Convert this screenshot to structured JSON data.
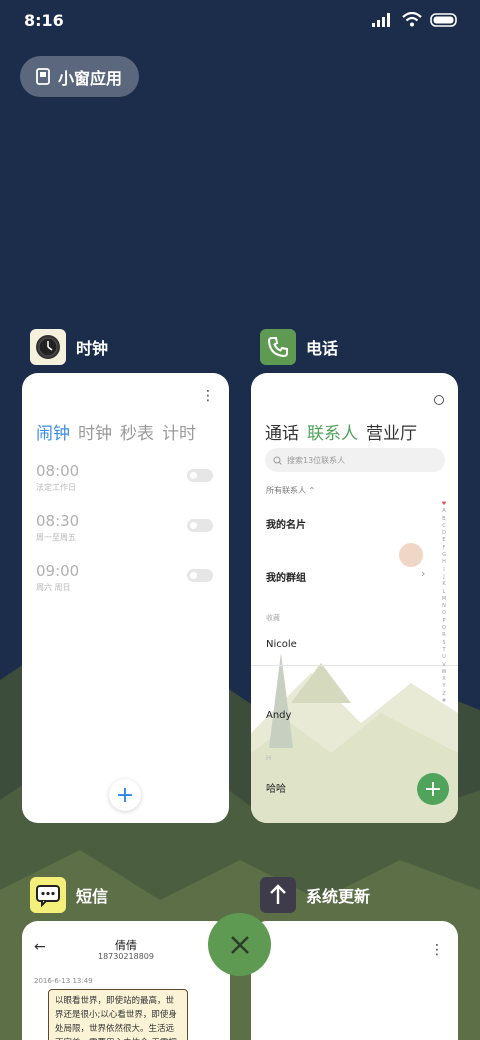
{
  "status_bar": {
    "time": "8:16"
  },
  "mini_window": {
    "label": "小窗应用"
  },
  "apps": {
    "clock": {
      "name": "时钟",
      "tabs": [
        "闹钟",
        "计时",
        "秒表",
        "计时"
      ],
      "tab_labels": {
        "alarm": "闹钟",
        "world": "时钟",
        "stopwatch": "秒表",
        "timer": "计时"
      },
      "alarms": [
        {
          "time": "08:00",
          "repeat": "法定工作日"
        },
        {
          "time": "08:30",
          "repeat": "周一至周五"
        },
        {
          "time": "09:00",
          "repeat": "周六 周日"
        }
      ],
      "add_label": "+"
    },
    "phone": {
      "name": "电话",
      "tabs": {
        "calls": "通话",
        "contacts": "联系人",
        "service": "营业厅"
      },
      "search_placeholder": "搜索13位联系人",
      "filter_label": "所有联系人",
      "my_card": "我的名片",
      "my_groups": "我的群组",
      "favorites_label": "收藏",
      "contacts": [
        "Nicole",
        "Andy",
        "哈哈"
      ],
      "section_h": "H",
      "index_letters": [
        "♥",
        "A",
        "B",
        "C",
        "D",
        "E",
        "F",
        "G",
        "H",
        "I",
        "J",
        "K",
        "L",
        "M",
        "N",
        "O",
        "P",
        "Q",
        "R",
        "S",
        "T",
        "U",
        "V",
        "W",
        "X",
        "Y",
        "Z",
        "#"
      ],
      "add_label": "+"
    },
    "sms": {
      "name": "短信",
      "contact_name": "倩倩",
      "contact_number": "18730218809",
      "date": "2016-6-13 13:49",
      "message": "以眼看世界，即使站的最高，世界还是很小;以心看世界，即使身处局限，世界依然很大。生活远不完美，需要用心去体会;无需拥有太"
    },
    "update": {
      "name": "系统更新"
    }
  },
  "colors": {
    "background": "#1b2d4a",
    "clock_accent": "#3a8ee6",
    "phone_accent": "#4fa35a",
    "close_button": "#5f9a53"
  }
}
